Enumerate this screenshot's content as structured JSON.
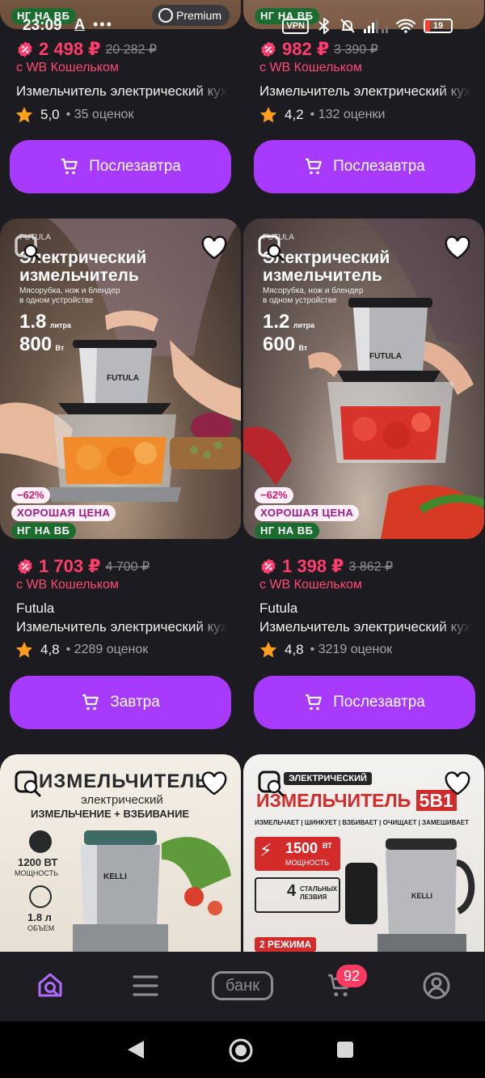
{
  "status_bar": {
    "time": "23:09",
    "left_glyph": "A",
    "vpn": "VPN",
    "battery": "19"
  },
  "colors": {
    "accent": "#a73afd",
    "price": "#ff3d6e",
    "background": "#1c1b20",
    "ng_badge": "#1a6d2f"
  },
  "top_cards": [
    {
      "top_badge": "НГ НА ВБ",
      "premium_label": "Premium",
      "price": "2 498 ₽",
      "old_price": "20 282 ₽",
      "wallet": "с WB Кошельком",
      "title": "Измельчитель электрический кухонный",
      "rating": "5,0",
      "reviews": "• 35 оценок",
      "button": "Послезавтра"
    },
    {
      "top_badge": "НГ НА ВБ",
      "price": "982 ₽",
      "old_price": "3 390 ₽",
      "wallet": "с WB Кошельком",
      "title": "Измельчитель электрический кухонный",
      "rating": "4,2",
      "reviews": "• 132 оценки",
      "button": "Послезавтра"
    }
  ],
  "mid_cards": [
    {
      "image_heading_1": "Электрический",
      "image_heading_2": "измельчитель",
      "image_sub": "Мясорубка, нож и блендер в одном устройстве",
      "volume": "1.8",
      "volume_unit": "литра",
      "power": "800",
      "power_unit": "Вт",
      "device_brand": "FUTULA",
      "discount": "−62%",
      "good_price": "ХОРОШАЯ ЦЕНА",
      "ng_badge": "НГ НА ВБ",
      "price": "1 703 ₽",
      "old_price": "4 700 ₽",
      "wallet": "с WB Кошельком",
      "brand": "Futula",
      "title": "Измельчитель электрический кухонный",
      "rating": "4,8",
      "reviews": "• 2289 оценок",
      "button": "Завтра"
    },
    {
      "image_heading_1": "Электрический",
      "image_heading_2": "измельчитель",
      "image_sub": "Мясорубка, нож и блендер в одном устройстве",
      "volume": "1.2",
      "volume_unit": "литра",
      "power": "600",
      "power_unit": "Вт",
      "device_brand": "FUTULA",
      "discount": "−62%",
      "good_price": "ХОРОШАЯ ЦЕНА",
      "ng_badge": "НГ НА ВБ",
      "price": "1 398 ₽",
      "old_price": "3 862 ₽",
      "wallet": "с WB Кошельком",
      "brand": "Futula",
      "title": "Измельчитель электрический кухонный",
      "rating": "4,8",
      "reviews": "• 3219 оценок",
      "button": "Послезавтра"
    }
  ],
  "bottom_cards": [
    {
      "heading": "ИЗМЕЛЬЧИТЕЛЬ",
      "sub": "электрический",
      "tag": "ИЗМЕЛЬЧЕНИЕ + ВЗБИВАНИЕ",
      "power": "1200 ВТ",
      "power_label": "МОЩНОСТЬ",
      "volume": "1.8 л",
      "volume_label": "ОБЪЕМ",
      "device_brand": "KELLI"
    },
    {
      "pre": "ЭЛЕКТРИЧЕСКИЙ",
      "heading": "ИЗМЕЛЬЧИТЕЛЬ",
      "heading_badge": "5В1",
      "functions": "ИЗМЕЛЬЧАЕТ | ШИНКУЕТ | ВЗБИВАЕТ | ОЧИЩАЕТ | ЗАМЕШИВАЕТ",
      "power": "1500",
      "power_unit": "ВТ",
      "power_label": "МОЩНОСТЬ",
      "blades_count": "4",
      "blades_label": "СТАЛЬНЫХ ЛЕЗВИЯ",
      "modes": "2 РЕЖИМА",
      "device_brand": "KELLI"
    }
  ],
  "bottom_nav": {
    "bank_label": "банк",
    "cart_count": "92"
  }
}
